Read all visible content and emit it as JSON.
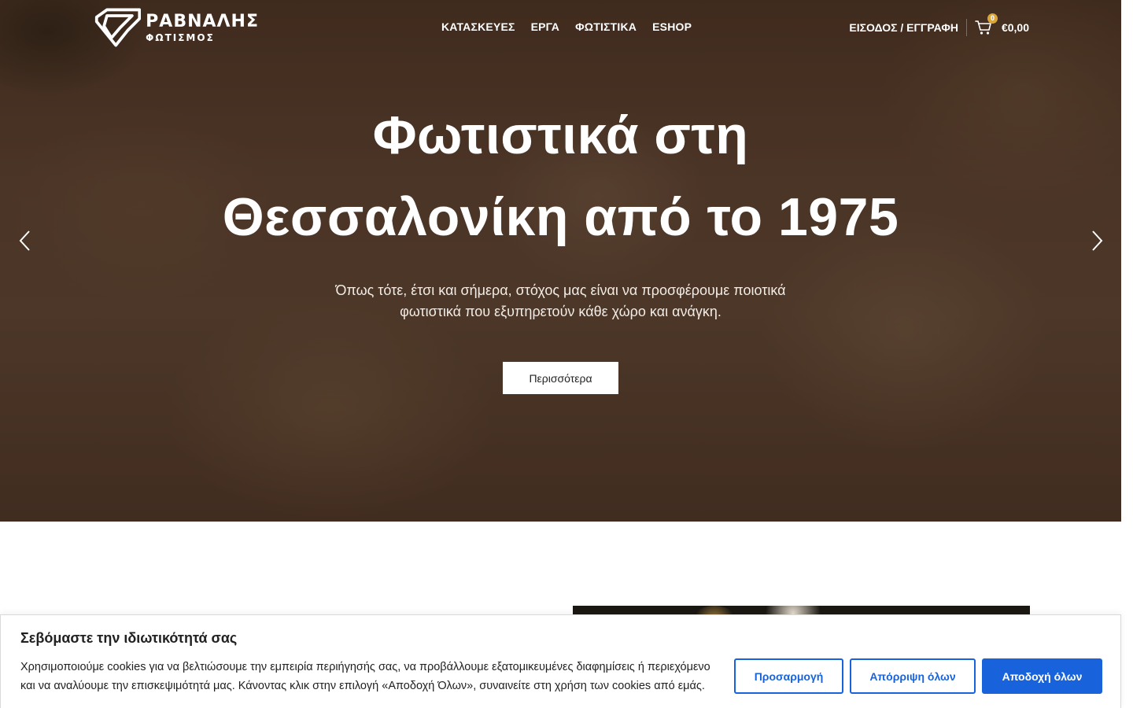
{
  "brand": {
    "name": "ΡΑΒΝΑΛΗΣ",
    "tagline": "ΦΩΤΙΣΜΟΣ"
  },
  "nav": {
    "items": [
      "ΚΑΤΑΣΚΕΥΕΣ",
      "ΕΡΓΑ",
      "ΦΩΤΙΣΤΙΚΑ",
      "ESHOP"
    ]
  },
  "header": {
    "login_label": "ΕΙΣΟΔΟΣ / ΕΓΓΡΑΦΗ",
    "cart_count": "0",
    "cart_total": "€0,00"
  },
  "hero": {
    "title_line1": "Φωτιστικά στη",
    "title_line2": "Θεσσαλονίκη από το 1975",
    "subtitle_line1": "Όπως τότε, έτσι και σήμερα, στόχος μας είναι να προσφέρουμε ποιοτικά",
    "subtitle_line2": "φωτιστικά που εξυπηρετούν κάθε χώρο και ανάγκη.",
    "button_label": "Περισσότερα"
  },
  "cookie": {
    "title": "Σεβόμαστε την ιδιωτικότητά σας",
    "text": "Χρησιμοποιούμε cookies για να βελτιώσουμε την εμπειρία περιήγησής σας, να προβάλλουμε εξατομικευμένες διαφημίσεις ή περιεχόμενο και να αναλύουμε την επισκεψιμότητά μας. Κάνοντας κλικ στην επιλογή «Αποδοχή Όλων», συναινείτε στη χρήση των cookies από εμάς.",
    "customize_label": "Προσαρμογή",
    "reject_label": "Απόρριψη όλων",
    "accept_label": "Αποδοχή όλων"
  },
  "colors": {
    "accent": "#1863dc",
    "cart_badge": "#d8a63a",
    "hero_bg": "#5a4030"
  },
  "icons": [
    "logo-icon",
    "cart-icon",
    "chevron-left-icon",
    "chevron-right-icon"
  ]
}
